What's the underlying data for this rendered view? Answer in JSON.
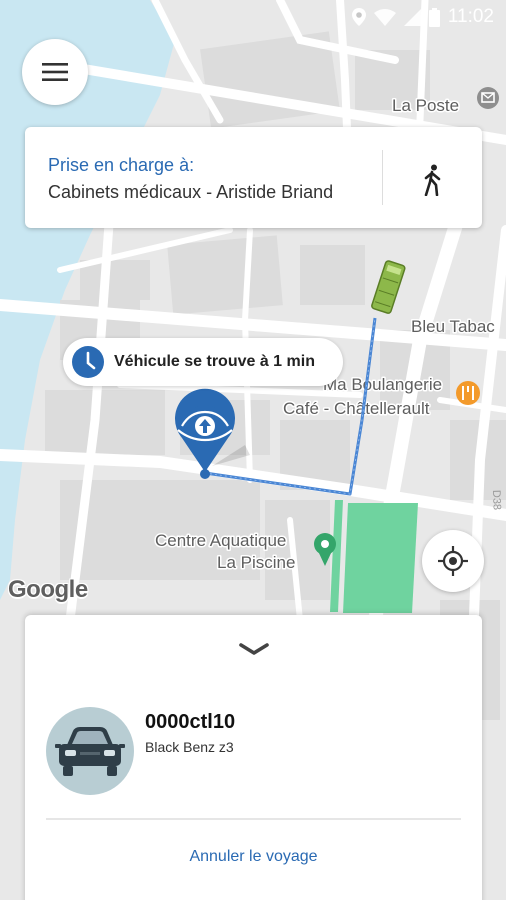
{
  "status_bar": {
    "time": "11:02",
    "icons": [
      "location-icon",
      "wifi-icon",
      "signal-icon",
      "battery-icon"
    ]
  },
  "menu": {
    "icon": "hamburger-menu-icon"
  },
  "pickup": {
    "title": "Prise en charge à:",
    "address": "Cabinets médicaux - Aristide Briand",
    "walk_icon": "walking-person-icon"
  },
  "eta": {
    "text": "Véhicule se trouve à 1 min",
    "icon": "clock-icon"
  },
  "map": {
    "labels": {
      "la_poste": "La Poste",
      "bleu_tabac": "Bleu Tabac",
      "boulangerie": "Ma Boulangerie",
      "cafe": "Café - Châtellerault",
      "centre_aquatique_1": "Centre Aquatique",
      "centre_aquatique_2": "La Piscine",
      "d38": "D38"
    },
    "attribution": "Google"
  },
  "vehicle": {
    "id": "0000ctl10",
    "model": "Black Benz z3",
    "icon": "car-icon"
  },
  "actions": {
    "cancel": "Annuler le voyage"
  },
  "colors": {
    "accent": "#2a6ab3",
    "route": "#4a86d4",
    "park": "#6fd39f",
    "water": "#c9e7f2",
    "bus": "#8db84a"
  }
}
